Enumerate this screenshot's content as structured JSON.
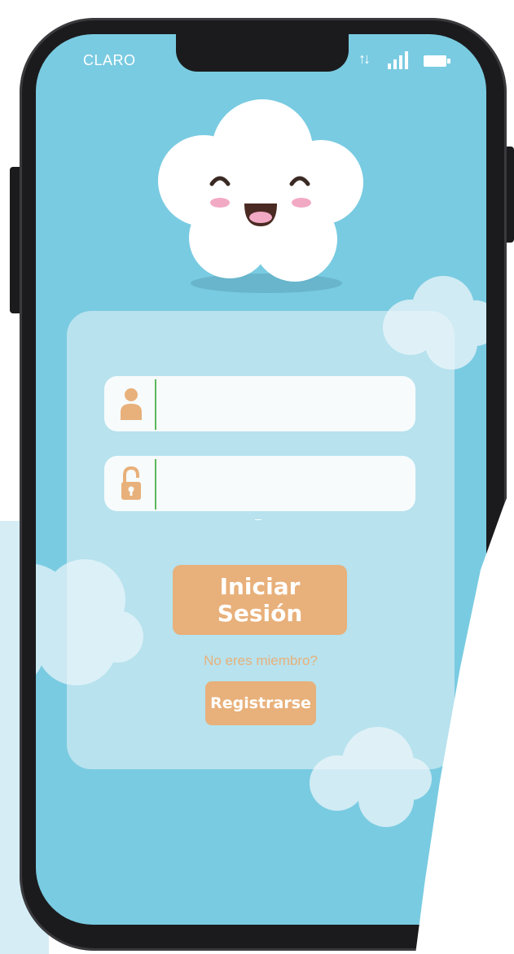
{
  "status_bar": {
    "carrier": "CLARO",
    "network_icon": "data-transfer-arrows-icon",
    "signal_icon": "signal-bars-icon",
    "battery_icon": "battery-icon"
  },
  "mascot": {
    "icon": "smiling-cloud-icon"
  },
  "login_form": {
    "username": {
      "value": "",
      "placeholder": "",
      "icon": "user-icon"
    },
    "password": {
      "value": "",
      "placeholder": "",
      "icon": "padlock-icon"
    },
    "login_button": "Iniciar Sesión",
    "not_member_text": "No eres miembro?",
    "register_button": "Registrarse"
  },
  "colors": {
    "sky": "#79cbe1",
    "accent": "#e8b07a",
    "input_divider": "#5cb85c",
    "phone_frame": "#1b1b1d"
  }
}
